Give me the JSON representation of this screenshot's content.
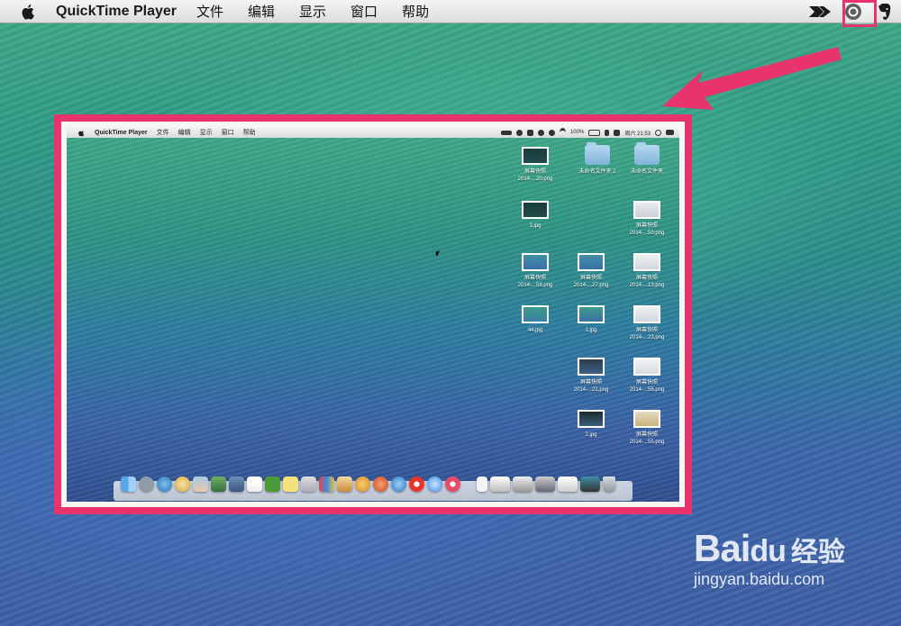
{
  "menubar": {
    "app_name": "QuickTime Player",
    "items": [
      "文件",
      "编辑",
      "显示",
      "窗口",
      "帮助"
    ]
  },
  "inner_screen": {
    "menubar": {
      "app_name": "QuickTime Player",
      "items": [
        "文件",
        "编辑",
        "显示",
        "窗口",
        "帮助"
      ],
      "battery": "100%",
      "clock": "周六 21:53"
    },
    "desktop_items": [
      {
        "caption1": "屏幕快照",
        "caption2": "2014-...20.png"
      },
      {
        "caption1": "未命名文件夹 2",
        "caption2": ""
      },
      {
        "caption1": "未命名文件夹",
        "caption2": ""
      },
      {
        "caption1": "3.jpg",
        "caption2": ""
      },
      {
        "caption1": "屏幕快照",
        "caption2": "2014-...50.png"
      },
      {
        "caption1": "屏幕快照",
        "caption2": "2014-...58.png"
      },
      {
        "caption1": "屏幕快照",
        "caption2": "2014-...27.png"
      },
      {
        "caption1": "屏幕快照",
        "caption2": "2014-...13.png"
      },
      {
        "caption1": "44.jpg",
        "caption2": ""
      },
      {
        "caption1": "1.jpg",
        "caption2": ""
      },
      {
        "caption1": "屏幕快照",
        "caption2": "2014-...23.png"
      },
      {
        "caption1": "屏幕快照",
        "caption2": "2014-...21.png"
      },
      {
        "caption1": "屏幕快照",
        "caption2": "2014-...56.png"
      },
      {
        "caption1": "2.jpg",
        "caption2": ""
      },
      {
        "caption1": "屏幕快照",
        "caption2": "2014-...55.png"
      }
    ]
  },
  "watermark": {
    "logo": "Bai",
    "logo2": "du",
    "sub": "经验",
    "url": "jingyan.baidu.com"
  },
  "colors": {
    "highlight": "#e8336c",
    "menubar": "#e6e9e6"
  }
}
